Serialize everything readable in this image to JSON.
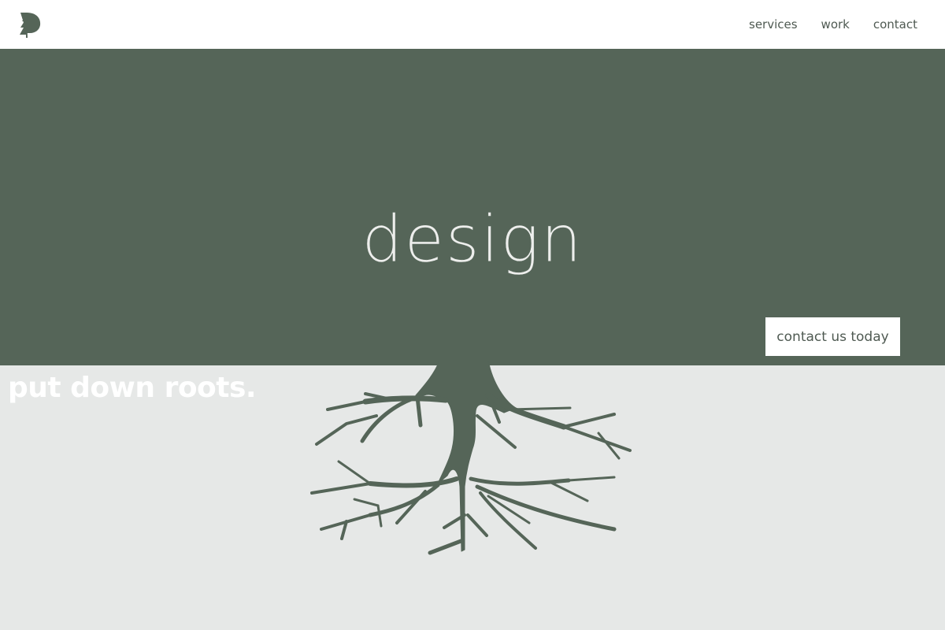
{
  "header": {
    "logo_icon": "pine-tree-logo-icon",
    "nav": [
      {
        "label": "services"
      },
      {
        "label": "work"
      },
      {
        "label": "contact"
      }
    ]
  },
  "hero": {
    "word": "design",
    "cta_label": "contact us today",
    "background": "#556558"
  },
  "lower": {
    "tagline": "put down roots.",
    "roots_icon": "tree-roots-icon",
    "background": "#e6e8e7"
  },
  "colors": {
    "accent": "#556558",
    "text": "#4f5a52",
    "white": "#ffffff"
  }
}
